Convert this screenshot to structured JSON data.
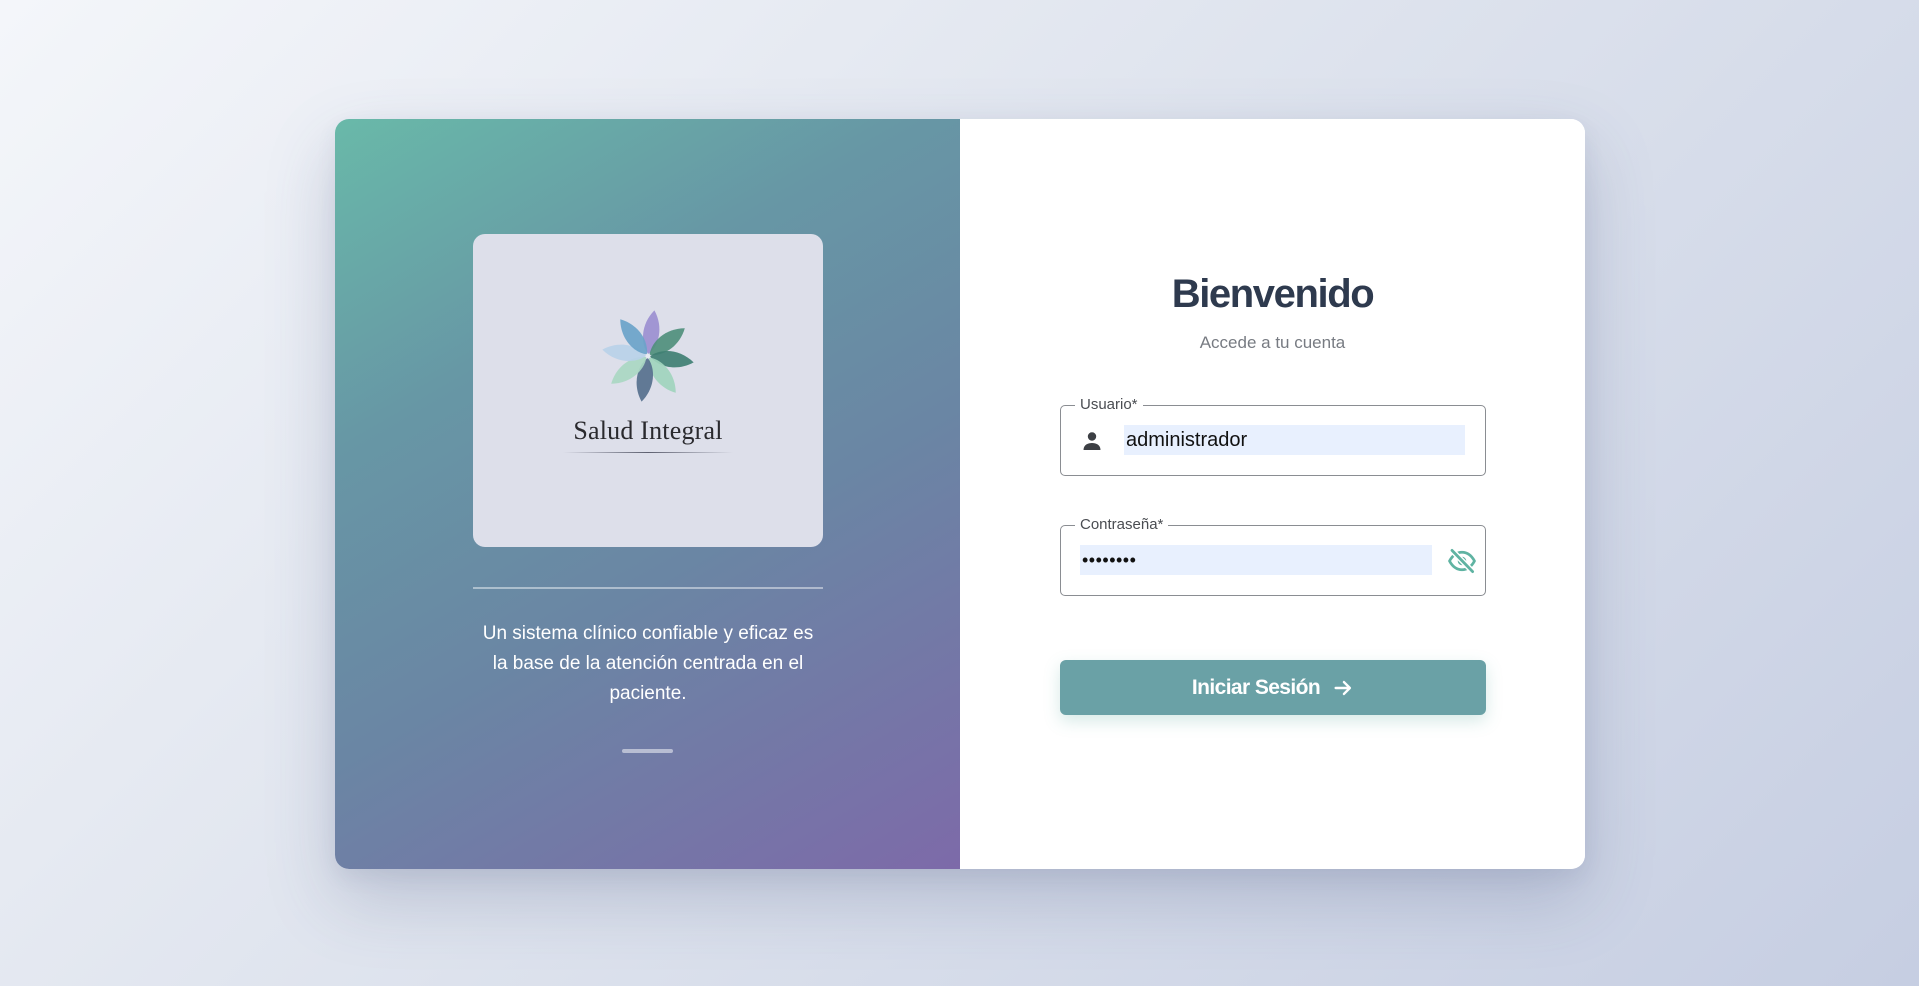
{
  "brand": {
    "name": "Salud Integral",
    "logo_icon": "flower-petals-logo"
  },
  "left_panel": {
    "tagline": "Un sistema clínico confiable y eficaz es la base de la atención centrada en el paciente."
  },
  "login": {
    "title": "Bienvenido",
    "subtitle": "Accede a tu cuenta",
    "username": {
      "label": "Usuario*",
      "value": "administrador",
      "icon": "person-icon"
    },
    "password": {
      "label": "Contraseña*",
      "value": "admin123",
      "toggle_icon": "eye-off-icon"
    },
    "submit_label": "Iniciar Sesión",
    "submit_icon": "arrow-right-icon"
  },
  "colors": {
    "accent": "#6aa1a6",
    "eye_icon": "#5fb3a2",
    "title_text": "#2e3a4e",
    "panel_gradient_start": "#69b9a9",
    "panel_gradient_end": "#7d6aa9"
  }
}
